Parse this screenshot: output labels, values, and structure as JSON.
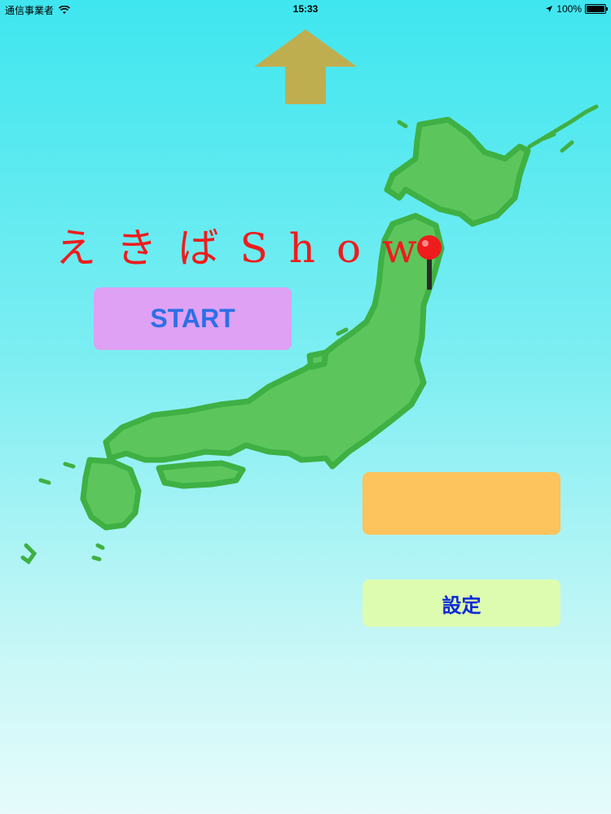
{
  "status_bar": {
    "carrier": "通信事業者",
    "time": "15:33",
    "battery": "100%",
    "battery_level": 1.0
  },
  "title": "えきばShow",
  "buttons": {
    "start_label": "START",
    "orange_label": "",
    "settings_label": "設定"
  },
  "colors": {
    "title": "#ee1c1c",
    "start_bg": "#dea1f4",
    "start_text": "#2d6fe6",
    "orange_bg": "#fdc35c",
    "settings_bg": "#ddfcb0",
    "settings_text": "#0b2ad6",
    "arrow": "#bfae50",
    "map_fill": "#57c257",
    "pin": "#ee1c1c"
  },
  "icons": {
    "top_arrow": "up-arrow-icon",
    "map": "japan-map",
    "pin": "map-pin-icon"
  }
}
